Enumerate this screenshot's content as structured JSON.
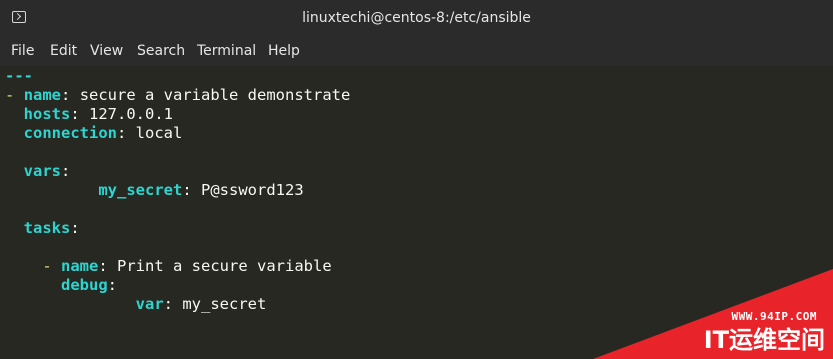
{
  "window": {
    "title": "linuxtechi@centos-8:/etc/ansible",
    "icon": "terminal-icon"
  },
  "menu": {
    "items": [
      "File",
      "Edit",
      "View",
      "Search",
      "Terminal",
      "Help"
    ]
  },
  "code": {
    "line1": "---",
    "line2_dash": "-",
    "line2_key": "name",
    "line2_val": "secure a variable demonstrate",
    "line3_key": "hosts",
    "line3_val": "127.0.0.1",
    "line4_key": "connection",
    "line4_val": "local",
    "line6_key": "vars",
    "line7_key": "my_secret",
    "line7_val": "P@ssword123",
    "line9_key": "tasks",
    "line11_dash": "-",
    "line11_key": "name",
    "line11_val": "Print a secure variable",
    "line12_key": "debug",
    "line13_key": "var",
    "line13_val": "my_secret"
  },
  "watermark": {
    "url": "WWW.94IP.COM",
    "text": "IT运维空间"
  },
  "colors": {
    "background": "#272822",
    "titlebar": "#2b2b2b",
    "key": "#2fd3cf",
    "dash": "#e6db74",
    "watermark_red": "#e8232a"
  }
}
